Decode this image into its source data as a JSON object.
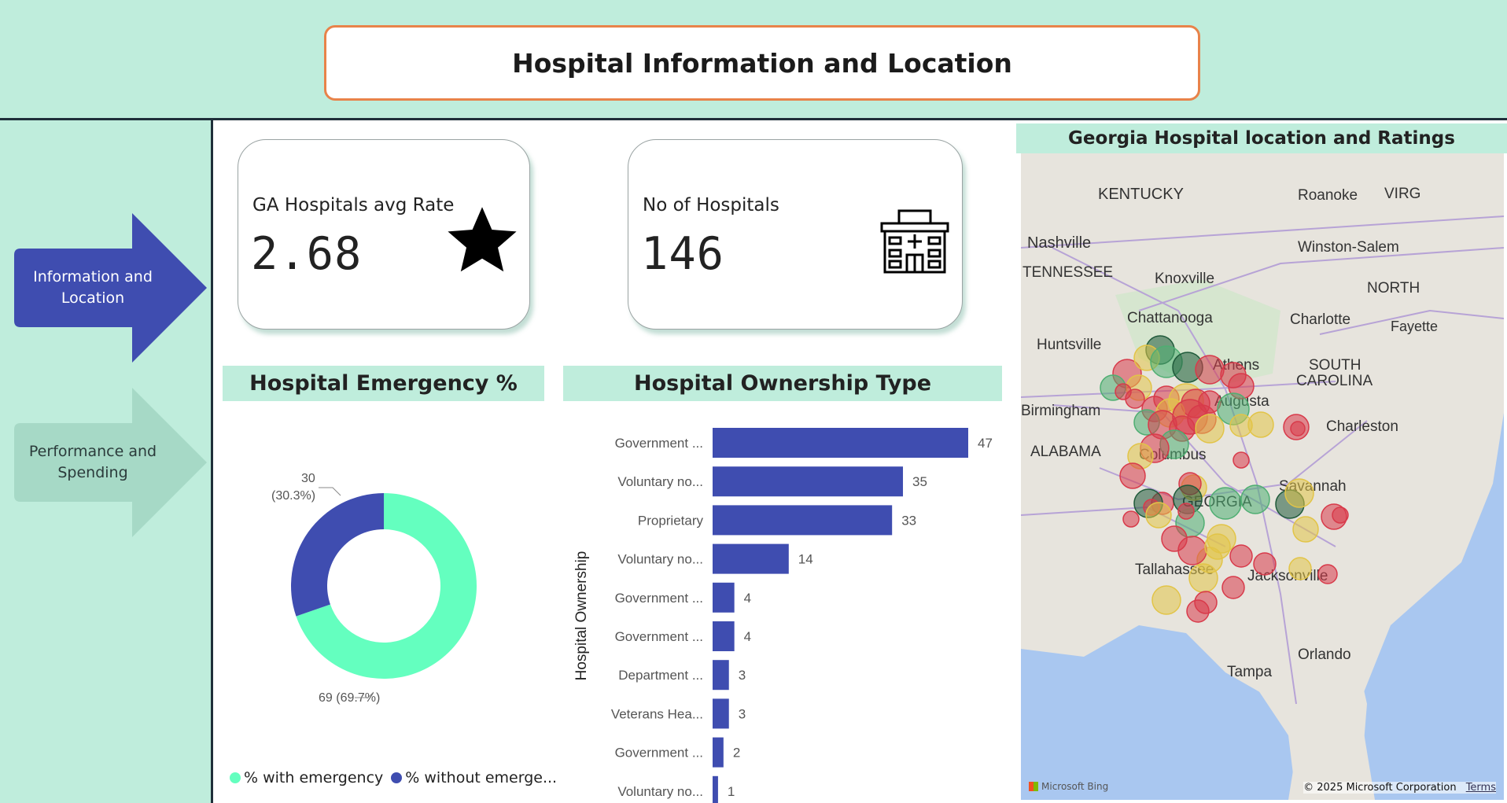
{
  "header": {
    "title": "Hospital Information and Location"
  },
  "nav": [
    {
      "label": "Information and Location",
      "active": true
    },
    {
      "label": "Performance and Spending",
      "active": false
    }
  ],
  "kpis": [
    {
      "label": "GA Hospitals avg Rate",
      "value": "2.68",
      "icon": "star-icon"
    },
    {
      "label": "No of Hospitals",
      "value": "146",
      "icon": "hospital-building-icon"
    }
  ],
  "emergency": {
    "title": "Hospital Emergency %",
    "legend": [
      "% with emergency",
      "% without emerge..."
    ]
  },
  "ownership": {
    "title": "Hospital Ownership Type"
  },
  "map": {
    "title": "Georgia Hospital location and Ratings",
    "labels": [
      "KENTUCKY",
      "Roanoke",
      "VIRG",
      "Nashville",
      "Winston-Salem",
      "TENNESSEE",
      "Knoxville",
      "NORTH",
      "Chattanooga",
      "Charlotte",
      "Fayette",
      "Huntsville",
      "Athens",
      "SOUTH",
      "CAROLINA",
      "Birmingham",
      "Augusta",
      "Charleston",
      "ALABAMA",
      "Columbus",
      "Savannah",
      "GEORGIA",
      "Tallahassee",
      "Jacksonville",
      "Orlando",
      "Tampa"
    ],
    "attribution": "Microsoft Bing",
    "copyright": "© 2025 Microsoft Corporation",
    "terms": "Terms"
  },
  "colors": {
    "accent": "#3f4db0",
    "mint": "#bfeddc",
    "donut_with": "#64ffbf",
    "donut_without": "#3f4db0"
  },
  "chart_data": [
    {
      "type": "pie",
      "title": "Hospital Emergency %",
      "categories": [
        "% with emergency",
        "% without emergency"
      ],
      "values": [
        69,
        30
      ],
      "data_labels": [
        "69 (69.7%)",
        "30 (30.3%)"
      ],
      "legend": "bottom-left"
    },
    {
      "type": "bar",
      "title": "Hospital Ownership Type",
      "ylabel": "Hospital Ownership",
      "orientation": "horizontal",
      "categories": [
        "Government ...",
        "Voluntary no...",
        "Proprietary",
        "Voluntary no...",
        "Government ...",
        "Government ...",
        "Department ...",
        "Veterans Hea...",
        "Government ...",
        "Voluntary no..."
      ],
      "values": [
        47,
        35,
        33,
        14,
        4,
        4,
        3,
        3,
        2,
        1
      ]
    }
  ]
}
